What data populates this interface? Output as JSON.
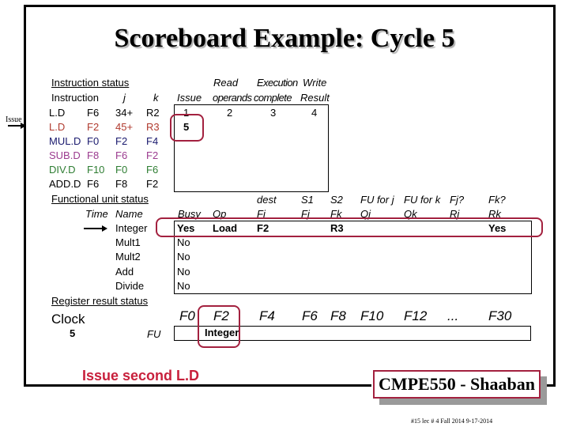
{
  "slide": {
    "title": "Scoreboard Example:  Cycle 5",
    "side_label": "Issue",
    "note": "Issue second L.D",
    "footer_title": "CMPE550 - Shaaban",
    "footer_sub": "#15   lec # 4 Fall 2014    9-17-2014",
    "accent_color": "#a3213f",
    "note_color": "#c8203c"
  },
  "instruction_status": {
    "heading": "Instruction status",
    "headers": {
      "instruction": "Instruction",
      "j": "j",
      "k": "k",
      "issue": "Issue",
      "read_top": "Read",
      "read_bottom": "operands",
      "exec_top": "Execution",
      "exec_bottom": "complete",
      "write_top": "Write",
      "write_bottom": "Result"
    },
    "rows": [
      {
        "op": "L.D",
        "dest": "F6",
        "j": "34+",
        "k": "R2",
        "issue": "1",
        "read": "2",
        "exec": "3",
        "write": "4",
        "color": "#000000"
      },
      {
        "op": "L.D",
        "dest": "F2",
        "j": "45+",
        "k": "R3",
        "issue": "5",
        "read": "",
        "exec": "",
        "write": "",
        "color": "#b03a2e"
      },
      {
        "op": "MUL.D",
        "dest": "F0",
        "j": "F2",
        "k": "F4",
        "issue": "",
        "read": "",
        "exec": "",
        "write": "",
        "color": "#1a1a6e"
      },
      {
        "op": "SUB.D",
        "dest": "F8",
        "j": "F6",
        "k": "F2",
        "issue": "",
        "read": "",
        "exec": "",
        "write": "",
        "color": "#9b3b8f"
      },
      {
        "op": "DIV.D",
        "dest": "F10",
        "j": "F0",
        "k": "F6",
        "issue": "",
        "read": "",
        "exec": "",
        "write": "",
        "color": "#2e7d32"
      },
      {
        "op": "ADD.D",
        "dest": "F6",
        "j": "F8",
        "k": "F2",
        "issue": "",
        "read": "",
        "exec": "",
        "write": "",
        "color": "#000000"
      }
    ]
  },
  "functional_unit_status": {
    "heading": "Functional unit status",
    "headers": {
      "time": "Time",
      "name": "Name",
      "busy": "Busy",
      "op": "Op",
      "dest_top": "dest",
      "dest_bottom": "Fi",
      "s1_top": "S1",
      "s1_bottom": "Fj",
      "s2_top": "S2",
      "s2_bottom": "Fk",
      "qj_top": "FU for j",
      "qj_bottom": "Qj",
      "qk_top": "FU for k",
      "qk_bottom": "Qk",
      "rj_top": "Fj?",
      "rj_bottom": "Rj",
      "rk_top": "Fk?",
      "rk_bottom": "Rk"
    },
    "rows": [
      {
        "time": "",
        "name": "Integer",
        "busy": "Yes",
        "op": "Load",
        "fi": "F2",
        "fj": "",
        "fk": "R3",
        "qj": "",
        "qk": "",
        "rj": "",
        "rk": "Yes"
      },
      {
        "time": "",
        "name": "Mult1",
        "busy": "No",
        "op": "",
        "fi": "",
        "fj": "",
        "fk": "",
        "qj": "",
        "qk": "",
        "rj": "",
        "rk": ""
      },
      {
        "time": "",
        "name": "Mult2",
        "busy": "No",
        "op": "",
        "fi": "",
        "fj": "",
        "fk": "",
        "qj": "",
        "qk": "",
        "rj": "",
        "rk": ""
      },
      {
        "time": "",
        "name": "Add",
        "busy": "No",
        "op": "",
        "fi": "",
        "fj": "",
        "fk": "",
        "qj": "",
        "qk": "",
        "rj": "",
        "rk": ""
      },
      {
        "time": "",
        "name": "Divide",
        "busy": "No",
        "op": "",
        "fi": "",
        "fj": "",
        "fk": "",
        "qj": "",
        "qk": "",
        "rj": "",
        "rk": ""
      }
    ]
  },
  "register_result_status": {
    "heading": "Register result status",
    "clock_label": "Clock",
    "clock_value": "5",
    "fu_label": "FU",
    "registers": [
      "F0",
      "F2",
      "F4",
      "F6",
      "F8",
      "F10",
      "F12",
      "...",
      "F30"
    ],
    "values": [
      "",
      "Integer",
      "",
      "",
      "",
      "",
      "",
      "",
      ""
    ]
  }
}
